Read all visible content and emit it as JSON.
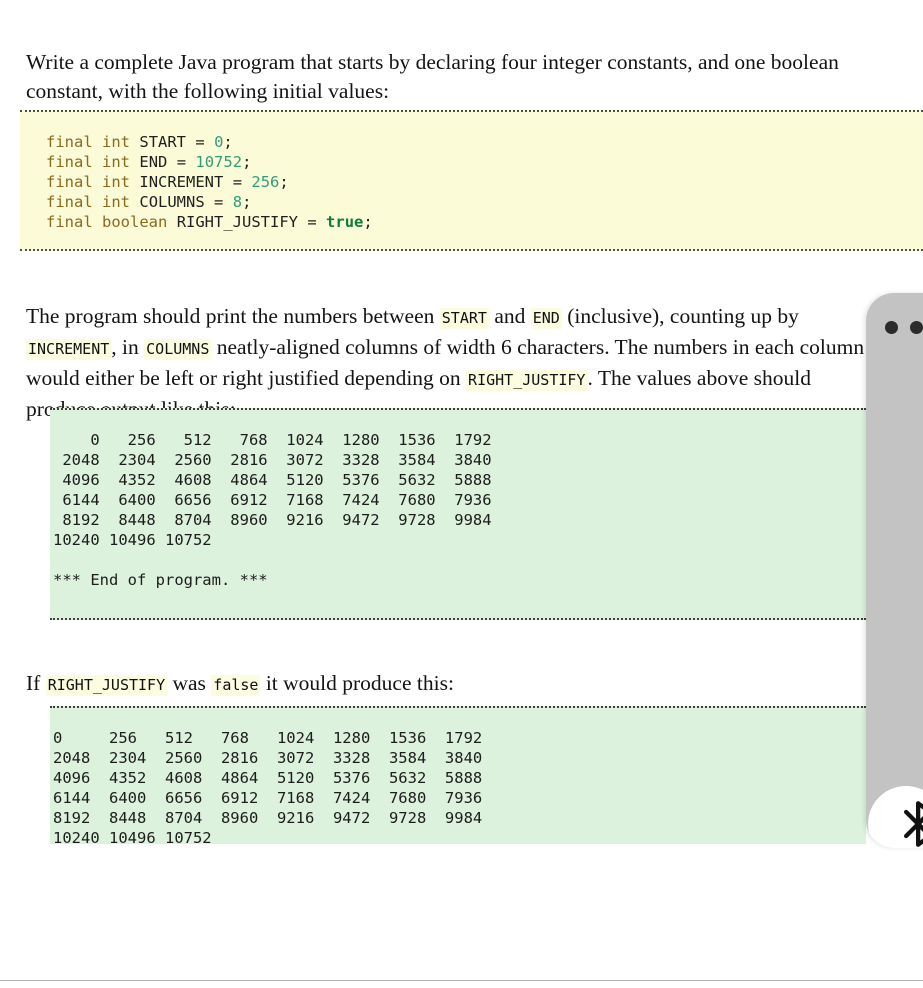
{
  "document": {
    "paragraphs": {
      "intro": {
        "text_before": "Write a complete Java program that starts by declaring four integer constants, and one boolean constant, with the following initial values:"
      },
      "explain": {
        "seg1": "The program should print the numbers between ",
        "code1": "START",
        "seg2": " and ",
        "code2": "END",
        "seg3": " (inclusive), counting up by ",
        "code3": "INCREMENT",
        "seg4": ", in ",
        "code4": "COLUMNS",
        "seg5": " neatly-aligned columns of width 6 characters. The numbers in each column would either be left or right justified depending on ",
        "code5": "RIGHT_JUSTIFY",
        "seg6": ". The values above should produce output like this:"
      },
      "false_case": {
        "seg1": "If ",
        "code1": "RIGHT_JUSTIFY",
        "seg2": " was ",
        "code2": "false",
        "seg3": " it would produce this:"
      }
    },
    "code_block": {
      "language": "java",
      "background_color": "#fbfbd8",
      "lines": [
        {
          "keyword1": "final",
          "keyword2": "int",
          "identifier": "START",
          "operator": "=",
          "value": "0",
          "value_type": "number",
          "terminator": ";"
        },
        {
          "keyword1": "final",
          "keyword2": "int",
          "identifier": "END",
          "operator": "=",
          "value": "10752",
          "value_type": "number",
          "terminator": ";"
        },
        {
          "keyword1": "final",
          "keyword2": "int",
          "identifier": "INCREMENT",
          "operator": "=",
          "value": "256",
          "value_type": "number",
          "terminator": ";"
        },
        {
          "keyword1": "final",
          "keyword2": "int",
          "identifier": "COLUMNS",
          "operator": "=",
          "value": "8",
          "value_type": "number",
          "terminator": ";"
        },
        {
          "keyword1": "final",
          "keyword2": "boolean",
          "identifier": "RIGHT_JUSTIFY",
          "operator": "=",
          "value": "true",
          "value_type": "boolean",
          "terminator": ";"
        }
      ]
    },
    "output_right_justified": {
      "background_color": "#ddf2dd",
      "text": "    0   256   512   768  1024  1280  1536  1792\n 2048  2304  2560  2816  3072  3328  3584  3840\n 4096  4352  4608  4864  5120  5376  5632  5888\n 6144  6400  6656  6912  7168  7424  7680  7936\n 8192  8448  8704  8960  9216  9472  9728  9984\n10240 10496 10752\n\n*** End of program. ***"
    },
    "output_left_justified": {
      "background_color": "#ddf2dd",
      "text": "0     256   512   768   1024  1280  1536  1792\n2048  2304  2560  2816  3072  3328  3584  3840\n4096  4352  4608  4864  5120  5376  5632  5888\n6144  6400  6656  6912  7168  7424  7680  7936\n8192  8448  8704  8960  9216  9472  9728  9984\n10240 10496 10752"
    }
  },
  "floating_panel": {
    "dots": [
      "dot-left",
      "dot-right"
    ],
    "bluetooth_icon": "bluetooth-icon"
  }
}
